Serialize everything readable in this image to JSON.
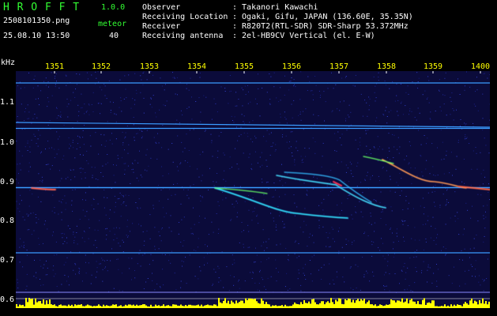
{
  "header": {
    "app_name": "H R O F F T",
    "version": "1.0.0",
    "file_name": "2508101350.png",
    "datetime": "25.08.10 13:50",
    "meteor_label": "meteor",
    "meteor_count": "40",
    "info": [
      {
        "key": "Observer",
        "value": ": Takanori Kawachi"
      },
      {
        "key": "Receiving Location",
        "value": ": Ogaki, Gifu, JAPAN (136.60E, 35.35N)"
      },
      {
        "key": "Receiver",
        "value": ": R820T2(RTL-SDR) SDR-Sharp 53.372MHz"
      },
      {
        "key": "Receiving antenna",
        "value": ": 2el-HB9CV Vertical (el. E-W)"
      }
    ]
  },
  "axis": {
    "y_unit": "kHz",
    "y_ticks": [
      "1.1",
      "1.0",
      "0.9",
      "0.8",
      "0.7",
      "0.6"
    ],
    "x_ticks": [
      "1351",
      "1352",
      "1353",
      "1354",
      "1355",
      "1356",
      "1357",
      "1358",
      "1359",
      "1400"
    ]
  },
  "colors": {
    "header_text": "#33ff33",
    "info_text": "#ffffff",
    "time_labels": "#ffff00",
    "spectrum_bg": "#0b0b3a",
    "carrier": "#3a9bff",
    "audio_level": "#ffff00"
  },
  "chart_data": {
    "type": "heatmap",
    "ylabel": "kHz",
    "x_categories": [
      "1351",
      "1352",
      "1353",
      "1354",
      "1355",
      "1356",
      "1357",
      "1358",
      "1359",
      "1400"
    ],
    "ylim": [
      0.58,
      1.18
    ],
    "carrier_lines_khz": [
      1.15,
      1.05,
      1.035,
      0.885,
      0.72
    ]
  }
}
